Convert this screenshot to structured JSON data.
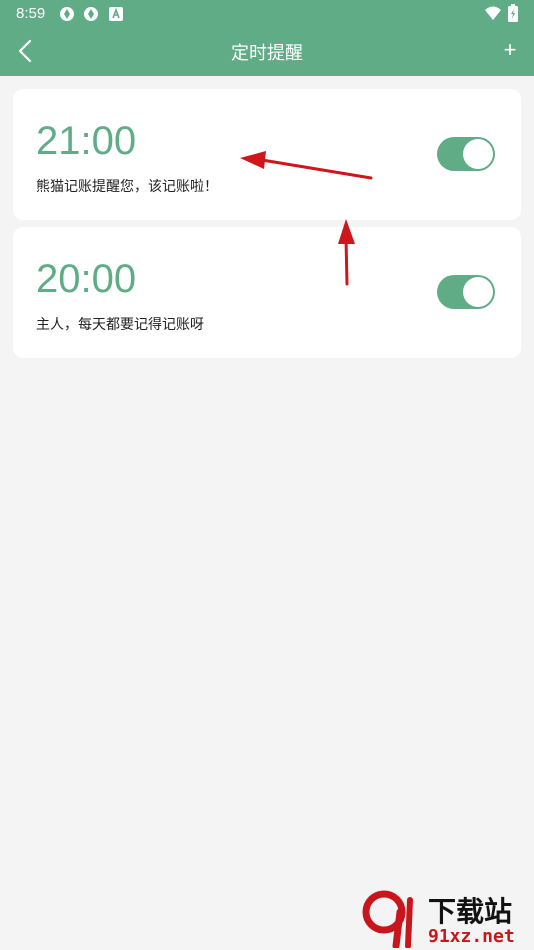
{
  "status_bar": {
    "time": "8:59",
    "icons": [
      "app-icon",
      "app-icon",
      "font-icon",
      "wifi-icon",
      "battery-icon"
    ]
  },
  "header": {
    "title": "定时提醒",
    "back_icon": "chevron-left-icon",
    "add_label": "+"
  },
  "reminders": [
    {
      "time": "21:00",
      "message": "熊猫记账提醒您，该记账啦！",
      "enabled": true
    },
    {
      "time": "20:00",
      "message": "主人，每天都要记得记账呀",
      "enabled": true
    }
  ],
  "colors": {
    "brand": "#5fac87",
    "background": "#f4f4f4",
    "annotation_arrow": "#d0161c"
  },
  "watermark": {
    "logo_text": "下载站",
    "url": "91xz.net"
  }
}
